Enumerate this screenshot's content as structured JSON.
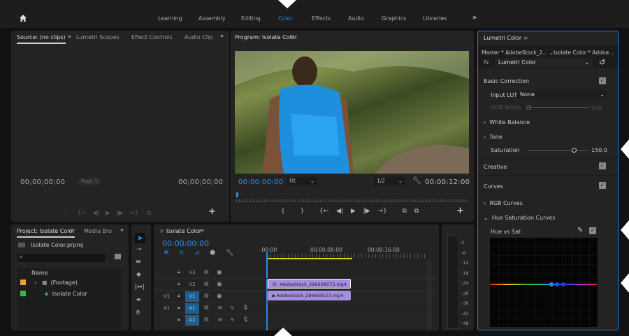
{
  "nav": {
    "items": [
      "Learning",
      "Assembly",
      "Editing",
      "Color",
      "Effects",
      "Audio",
      "Graphics",
      "Libraries"
    ],
    "active": "Color",
    "more": "»"
  },
  "source": {
    "tabs": [
      "Source: (no clips)",
      "Lumetri Scopes",
      "Effect Controls",
      "Audio Clip"
    ],
    "more": "»",
    "tc_left": "00;00;00;00",
    "tc_right": "00;00;00;00",
    "page": "Page 1"
  },
  "program": {
    "title": "Program: Isolate Color",
    "timecode": "00:00:00:00",
    "zoom": "Fit",
    "resolution": "1/2",
    "duration": "00:00:12:00"
  },
  "lumetri": {
    "title": "Lumetri Color",
    "master": "Master * AdobeStock_2...",
    "clip": "Isolate Color * Adobe...",
    "fx": "fx",
    "effect": "Lumetri Color",
    "basic": "Basic Correction",
    "input_lut_label": "Input LUT",
    "input_lut": "None",
    "hdr_label": "HDR White",
    "hdr_value": "100",
    "white_balance": "White Balance",
    "tone": "Tone",
    "saturation_label": "Saturation",
    "saturation": "150.0",
    "saturation_fraction": 0.75,
    "creative": "Creative",
    "curves": "Curves",
    "rgb_curves": "RGB Curves",
    "hue_sat_curves": "Hue Saturation Curves",
    "hue_vs_sat": "Hue vs Sat"
  },
  "project": {
    "tabs": [
      "Project: Isolate Color",
      "Media Bro"
    ],
    "more": "»",
    "file": "Isolate Color.prproj",
    "column": "Name",
    "items": [
      {
        "name": "(Footage)",
        "color": "#f0a030"
      },
      {
        "name": "Isolate Color",
        "color": "#3cb44b"
      }
    ]
  },
  "timeline": {
    "title": "Isolate Color",
    "timecode": "00:00:00:00",
    "ruler": [
      ":00:00",
      "00:00:08:00",
      "00:00:16:00"
    ],
    "tracks": [
      {
        "src": "",
        "name": "V3"
      },
      {
        "src": "",
        "name": "V2"
      },
      {
        "src": "V1",
        "name": "V1"
      },
      {
        "src": "A1",
        "name": "A1"
      },
      {
        "src": "",
        "name": "A2"
      }
    ],
    "clip_v2": "AdobeStock_286608573.mp4",
    "clip_v1": "AdobeStock_286608573.mp4",
    "clip_fx": "fx",
    "mute": "M",
    "solo": "S"
  },
  "meter": {
    "ticks": [
      "0",
      "-6",
      "-12",
      "-18",
      "-24",
      "-30",
      "-36",
      "-42",
      "-48"
    ]
  }
}
